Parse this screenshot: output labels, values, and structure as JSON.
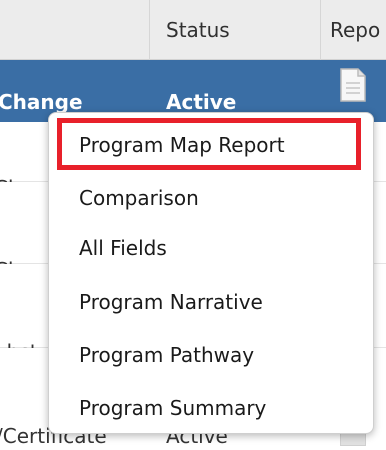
{
  "table": {
    "header": {
      "status_label": "Status",
      "report_label": "Repo"
    },
    "selected_row": {
      "type_fragment": "Change",
      "status": "Active"
    },
    "rows": [
      {
        "type_fragment": "Cha"
      },
      {
        "type_fragment": "Cha"
      },
      {
        "type_fragment": "ubst"
      },
      {
        "type_fragment": "/Certificate",
        "status": "Active"
      }
    ]
  },
  "report_menu": {
    "items": [
      {
        "label": "Program Map Report",
        "highlighted": true
      },
      {
        "label": "Comparison"
      },
      {
        "label": "All Fields"
      },
      {
        "label": "Program Narrative"
      },
      {
        "label": "Program Pathway"
      },
      {
        "label": "Program Summary"
      }
    ],
    "highlight_color": "#e8202a"
  },
  "colors": {
    "selected_row_bg": "#3a6ea5",
    "header_bg": "#ececec"
  },
  "icons": {
    "report": "document-icon"
  }
}
